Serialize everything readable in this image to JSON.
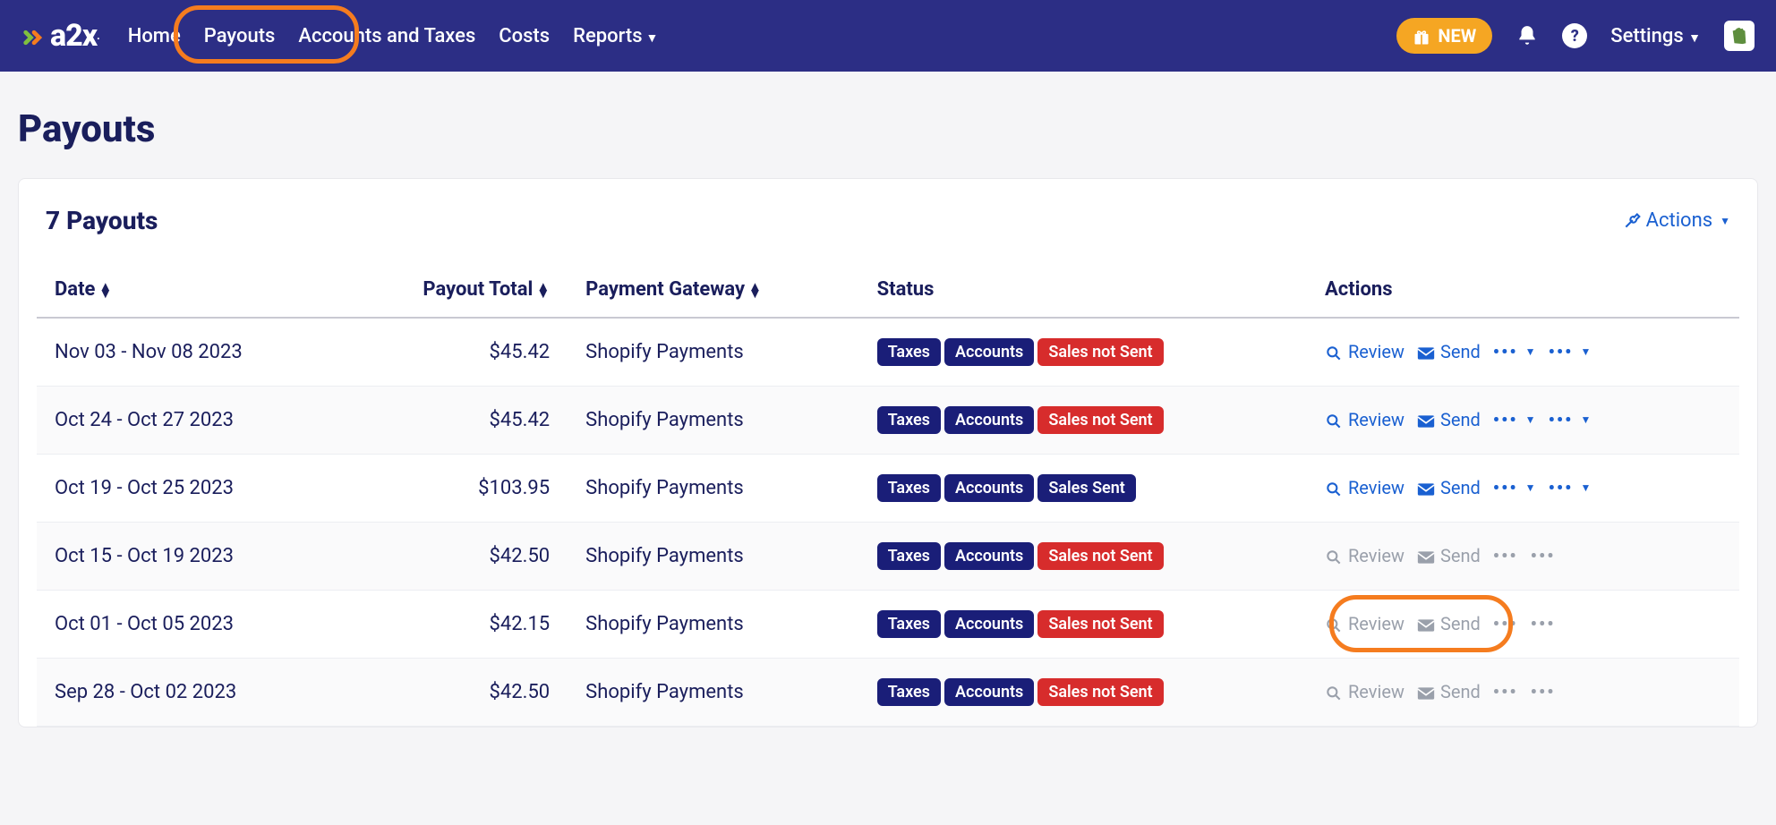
{
  "nav": {
    "brand": "a2x",
    "links": {
      "home": "Home",
      "payouts": "Payouts",
      "accounts": "Accounts and Taxes",
      "costs": "Costs",
      "reports": "Reports"
    },
    "new_label": "NEW",
    "settings_label": "Settings"
  },
  "page": {
    "title": "Payouts",
    "count_label": "7 Payouts",
    "actions_label": "Actions"
  },
  "columns": {
    "date": "Date",
    "total": "Payout Total",
    "gateway": "Payment Gateway",
    "status": "Status",
    "actions": "Actions"
  },
  "labels": {
    "review": "Review",
    "send": "Send"
  },
  "badges": {
    "taxes": "Taxes",
    "accounts": "Accounts",
    "sales_not_sent": "Sales not Sent",
    "sales_sent": "Sales Sent"
  },
  "rows": [
    {
      "date": "Nov 03 - Nov 08 2023",
      "total": "$45.42",
      "gateway": "Shopify Payments",
      "sales_sent": false,
      "active": true
    },
    {
      "date": "Oct 24 - Oct 27 2023",
      "total": "$45.42",
      "gateway": "Shopify Payments",
      "sales_sent": false,
      "active": true
    },
    {
      "date": "Oct 19 - Oct 25 2023",
      "total": "$103.95",
      "gateway": "Shopify Payments",
      "sales_sent": true,
      "active": true
    },
    {
      "date": "Oct 15 - Oct 19 2023",
      "total": "$42.50",
      "gateway": "Shopify Payments",
      "sales_sent": false,
      "active": false
    },
    {
      "date": "Oct 01 - Oct 05 2023",
      "total": "$42.15",
      "gateway": "Shopify Payments",
      "sales_sent": false,
      "active": false
    },
    {
      "date": "Sep 28 - Oct 02 2023",
      "total": "$42.50",
      "gateway": "Shopify Payments",
      "sales_sent": false,
      "active": false
    }
  ]
}
